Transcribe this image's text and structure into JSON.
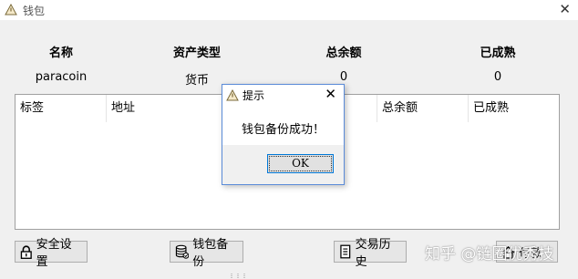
{
  "window": {
    "title": "钱包",
    "icon": "warning-icon",
    "close_icon": "close-icon"
  },
  "summary": {
    "headers": [
      "名称",
      "资产类型",
      "总余额",
      "已成熟"
    ],
    "values": [
      "paracoin",
      "货币",
      "0",
      "0"
    ]
  },
  "list": {
    "columns": [
      "标签",
      "地址",
      "总余额",
      "已成熟"
    ]
  },
  "buttons": {
    "security": {
      "label": "安全设置",
      "icon": "lock-icon"
    },
    "backup": {
      "label": "钱包备份",
      "icon": "database-icon"
    },
    "history": {
      "label": "交易历史",
      "icon": "document-icon"
    },
    "payment": {
      "label": "付款",
      "icon": "payment-icon"
    }
  },
  "dialog": {
    "title": "提示",
    "message": "钱包备份成功！",
    "ok_label": "OK",
    "icon": "warning-icon"
  },
  "watermark": {
    "text": "知乎 @链圈优秀技"
  }
}
